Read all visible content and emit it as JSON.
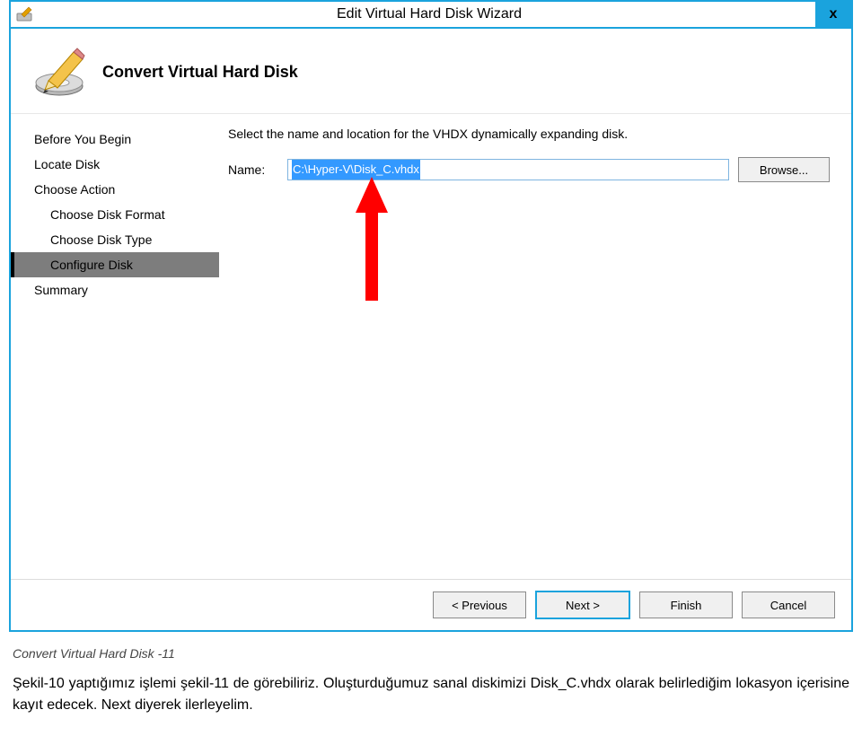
{
  "window": {
    "title": "Edit Virtual Hard Disk Wizard",
    "close_label": "x"
  },
  "header": {
    "title": "Convert Virtual Hard Disk"
  },
  "nav": {
    "items": [
      {
        "label": "Before You Begin",
        "sub": false,
        "selected": false
      },
      {
        "label": "Locate Disk",
        "sub": false,
        "selected": false
      },
      {
        "label": "Choose Action",
        "sub": false,
        "selected": false
      },
      {
        "label": "Choose Disk Format",
        "sub": true,
        "selected": false
      },
      {
        "label": "Choose Disk Type",
        "sub": true,
        "selected": false
      },
      {
        "label": "Configure Disk",
        "sub": true,
        "selected": true
      },
      {
        "label": "Summary",
        "sub": false,
        "selected": false
      }
    ]
  },
  "content": {
    "instruction": "Select the name and location for the VHDX dynamically expanding disk.",
    "name_label": "Name:",
    "name_value": "C:\\Hyper-V\\Disk_C.vhdx",
    "browse_label": "Browse..."
  },
  "footer": {
    "previous": "< Previous",
    "next": "Next >",
    "finish": "Finish",
    "cancel": "Cancel"
  },
  "caption": {
    "figure": "Convert Virtual Hard Disk -11",
    "paragraph": "Şekil-10 yaptığımız işlemi şekil-11 de görebiliriz. Oluşturduğumuz sanal diskimizi Disk_C.vhdx olarak belirlediğim lokasyon içerisine kayıt edecek. Next diyerek ilerleyelim."
  }
}
